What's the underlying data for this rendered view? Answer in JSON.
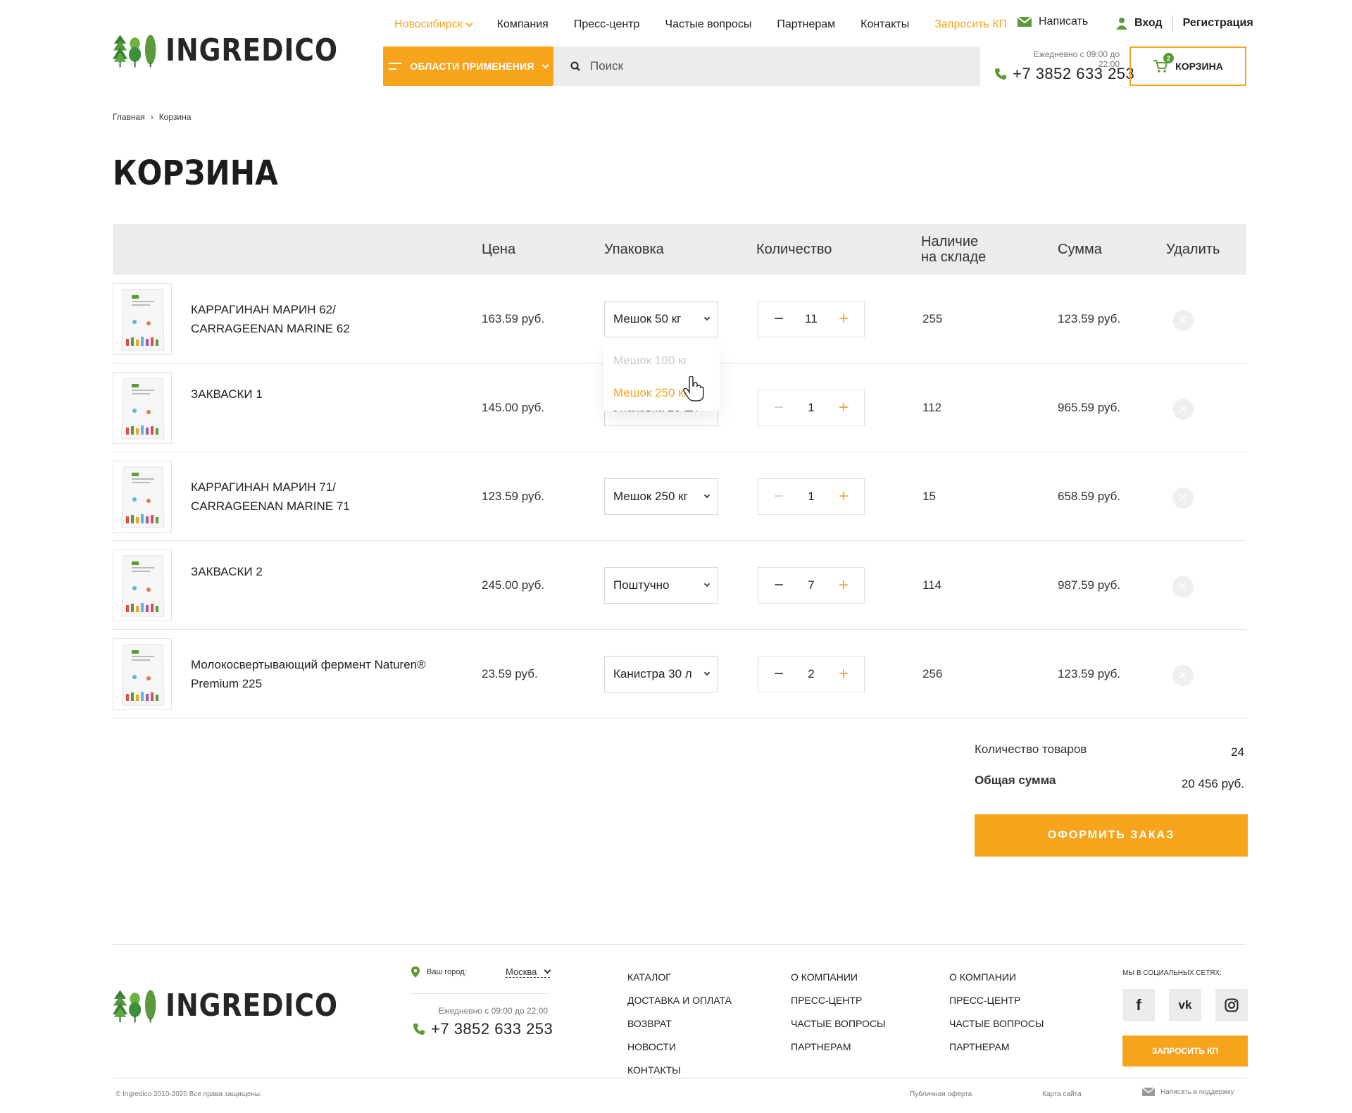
{
  "header": {
    "logo_text": "INGREDICO",
    "city": "Новосибирск",
    "nav": [
      "Компания",
      "Пресс-центр",
      "Частые вопросы",
      "Партнерам",
      "Контакты"
    ],
    "request_kp": "Запросить КП",
    "write": "Написать",
    "login": "Вход",
    "register": "Регистрация",
    "areas_button": "ОБЛАСТИ ПРИМЕНЕНИЯ",
    "search_placeholder": "Поиск",
    "hours": "Ежедневно с 09:00 до 22:00",
    "phone": "+7 3852 633 253",
    "cart_label": "КОРЗИНА",
    "cart_count": "2"
  },
  "breadcrumbs": [
    "Главная",
    "Корзина"
  ],
  "page_title": "КОРЗИНА",
  "table": {
    "headers": {
      "price": "Цена",
      "pack": "Упаковка",
      "qty": "Количество",
      "stock_1": "Наличие",
      "stock_2": "на складе",
      "sum": "Сумма",
      "delete": "Удалить"
    },
    "rows": [
      {
        "name": "КАРРАГИНАН МАРИН 62/ CARRAGEENAN MARINE 62",
        "price": "163.59 руб.",
        "pack": "Мешок 50 кг",
        "qty": "11",
        "stock": "255",
        "sum": "123.59 руб."
      },
      {
        "name": "ЗАКВАСКИ 1",
        "price": "145.00 руб.",
        "pack": "Упаковка 10 шт",
        "qty": "1",
        "stock": "112",
        "sum": "965.59 руб."
      },
      {
        "name": "КАРРАГИНАН МАРИН 71/ CARRAGEENAN MARINE 71",
        "price": "123.59 руб.",
        "pack": "Мешок 250 кг",
        "qty": "1",
        "stock": "15",
        "sum": "658.59 руб."
      },
      {
        "name": "ЗАКВАСКИ 2",
        "price": "245.00 руб.",
        "pack": "Поштучно",
        "qty": "7",
        "stock": "114",
        "sum": "987.59 руб."
      },
      {
        "name": "Молокосвертывающий фермент Naturen® Premium 225",
        "price": "23.59 руб.",
        "pack": "Канистра 30 л",
        "qty": "2",
        "stock": "256",
        "sum": "123.59 руб."
      }
    ],
    "dropdown_options": [
      "Мешок 100 кг",
      "Мешок 250 кг"
    ]
  },
  "summary": {
    "count_label": "Количество товаров",
    "count_value": "24",
    "total_label": "Общая сумма",
    "total_value": "20 456 руб.",
    "order_button": "ОФОРМИТЬ ЗАКАЗ"
  },
  "footer": {
    "city_label": "Ваш город:",
    "city_value": "Москва",
    "hours": "Ежедневно с 09:00 до 22:00",
    "phone": "+7 3852 633 253",
    "col1": [
      "КАТАЛОГ",
      "ДОСТАВКА И ОПЛАТА",
      "ВОЗВРАТ",
      "НОВОСТИ",
      "КОНТАКТЫ"
    ],
    "col2": [
      "О КОМПАНИИ",
      "ПРЕСС-ЦЕНТР",
      "ЧАСТЫЕ ВОПРОСЫ",
      "ПАРТНЕРАМ"
    ],
    "col3": [
      "О КОМПАНИИ",
      "ПРЕСС-ЦЕНТР",
      "ЧАСТЫЕ ВОПРОСЫ",
      "ПАРТНЕРАМ"
    ],
    "social_title": "МЫ В СОЦИАЛЬНЫХ СЕТЯХ:",
    "social": {
      "facebook": "f",
      "vk": "vk",
      "instagram": "instagram-icon"
    },
    "request_kp": "ЗАПРОСИТЬ КП",
    "copyright": "© Ingredico 2010-2020 Все права защищены.",
    "offer": "Публичная оферта",
    "sitemap": "Карта сайта",
    "support": "Написать в поддержку"
  },
  "colors": {
    "accent": "#f7a41d",
    "green": "#5b9b37",
    "header_bg": "#ececec"
  }
}
